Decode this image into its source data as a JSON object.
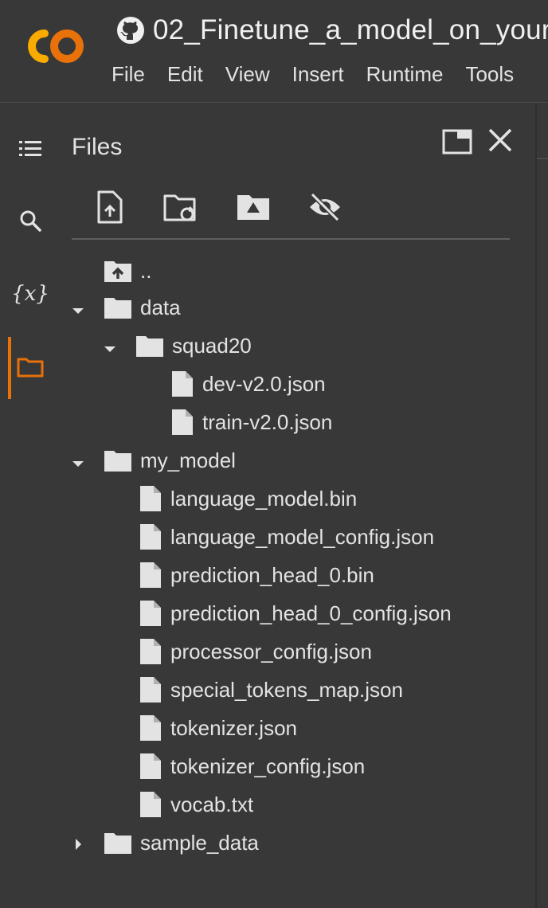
{
  "header": {
    "notebook_title": "02_Finetune_a_model_on_your",
    "menu": [
      "File",
      "Edit",
      "View",
      "Insert",
      "Runtime",
      "Tools"
    ]
  },
  "sidebar": {
    "items": [
      {
        "name": "table-of-contents",
        "icon": "list-icon"
      },
      {
        "name": "search",
        "icon": "search-icon"
      },
      {
        "name": "variables",
        "icon": "variables-icon",
        "glyph": "{x}"
      },
      {
        "name": "files",
        "icon": "folder-icon",
        "active": true
      }
    ]
  },
  "files_panel": {
    "title": "Files",
    "toolbar": [
      "upload-file-icon",
      "refresh-folder-icon",
      "mount-drive-icon",
      "hide-files-icon"
    ],
    "tree": [
      {
        "label": "..",
        "type": "parent"
      },
      {
        "label": "data",
        "type": "folder",
        "expanded": true
      },
      {
        "label": "squad20",
        "type": "folder",
        "expanded": true
      },
      {
        "label": "dev-v2.0.json",
        "type": "file"
      },
      {
        "label": "train-v2.0.json",
        "type": "file"
      },
      {
        "label": "my_model",
        "type": "folder",
        "expanded": true
      },
      {
        "label": "language_model.bin",
        "type": "file"
      },
      {
        "label": "language_model_config.json",
        "type": "file"
      },
      {
        "label": "prediction_head_0.bin",
        "type": "file"
      },
      {
        "label": "prediction_head_0_config.json",
        "type": "file"
      },
      {
        "label": "processor_config.json",
        "type": "file"
      },
      {
        "label": "special_tokens_map.json",
        "type": "file"
      },
      {
        "label": "tokenizer.json",
        "type": "file"
      },
      {
        "label": "tokenizer_config.json",
        "type": "file"
      },
      {
        "label": "vocab.txt",
        "type": "file"
      },
      {
        "label": "sample_data",
        "type": "folder",
        "expanded": false
      }
    ]
  },
  "colors": {
    "background": "#383838",
    "accent": "#e8710a",
    "logo_orange": "#f9ab00",
    "text": "#e3e3e3"
  }
}
